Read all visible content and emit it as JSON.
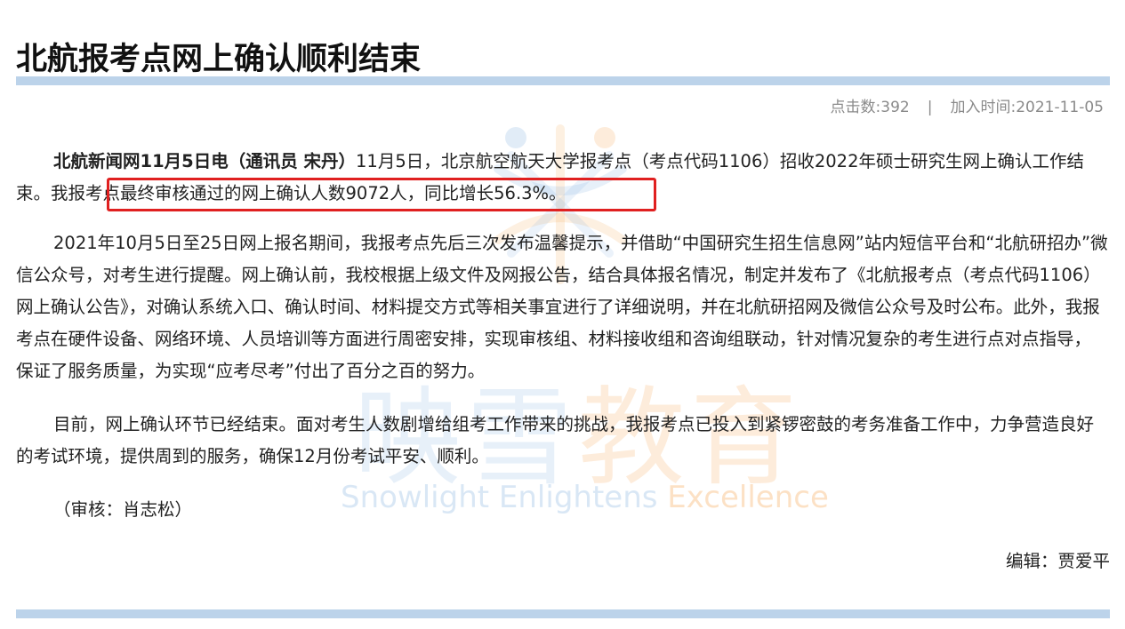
{
  "article": {
    "title": "北航报考点网上确认顺利结束",
    "clicks": "点击数:392",
    "separator": "|",
    "date": "加入时间:2021-11-05",
    "p1_lead": "北航新闻网11月5日电（通讯员 宋丹）",
    "p1_text": "11月5日，北京航空航天大学报考点（考点代码1106）招收2022年硕士研究生网上确认工作结束。",
    "p1_highlight": "我报考点最终审核通过的网上确认人数9072人，同比增长56.3%。",
    "p2": "2021年10月5日至25日网上报名期间，我报考点先后三次发布温馨提示，并借助“中国研究生招生信息网”站内短信平台和“北航研招办”微信公众号，对考生进行提醒。网上确认前，我校根据上级文件及网报公告，结合具体报名情况，制定并发布了《北航报考点（考点代码1106）网上确认公告》，对确认系统入口、确认时间、材料提交方式等相关事宜进行了详细说明，并在北航研招网及微信公众号及时公布。此外，我报考点在硬件设备、网络环境、人员培训等方面进行周密安排，实现审核组、材料接收组和咨询组联动，针对情况复杂的考生进行点对点指导，保证了服务质量，为实现“应考尽考”付出了百分之百的努力。",
    "p3": "目前，网上确认环节已经结束。面对考生人数剧增给组考工作带来的挑战，我报考点已投入到紧锣密鼓的考务准备工作中，力争营造良好的考试环境，提供周到的服务，确保12月份考试平安、顺利。",
    "reviewer": "（审核：肖志松）",
    "editor": "编辑：贾爱平"
  },
  "watermark": {
    "cn_blue": "映雪",
    "cn_orange": "教育",
    "en_blue": "Snowlight Enlightens ",
    "en_orange": "Excellence"
  },
  "colors": {
    "rule": "#bcd3ea",
    "highlight_box": "#e02020",
    "meta_text": "#8a8a8a"
  }
}
